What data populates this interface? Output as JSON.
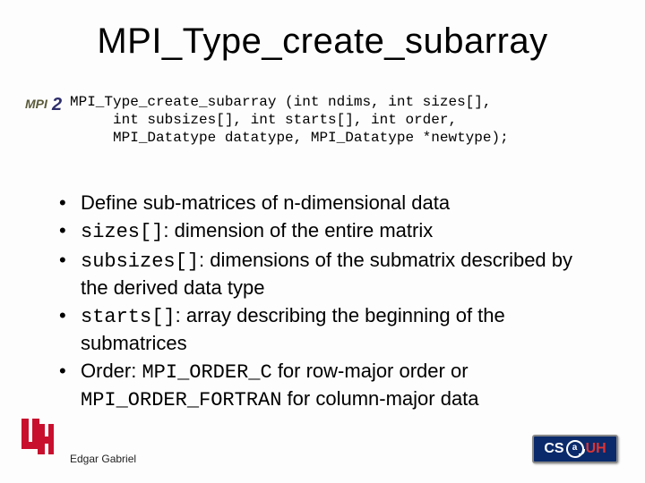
{
  "title": "MPI_Type_create_subarray",
  "signature": "MPI_Type_create_subarray (int ndims, int sizes[],\n     int subsizes[], int starts[], int order,\n     MPI_Datatype datatype, MPI_Datatype *newtype);",
  "bullets": [
    {
      "pre": "",
      "code": "",
      "post": "Define sub-matrices of n-dimensional data"
    },
    {
      "pre": "",
      "code": "sizes[]",
      "post": ": dimension of the entire matrix"
    },
    {
      "pre": "",
      "code": "subsizes[]",
      "post": ": dimensions of the submatrix described by the derived data type"
    },
    {
      "pre": "",
      "code": "starts[]",
      "post": ": array describing the beginning of the submatrices"
    },
    {
      "pre": "Order: ",
      "code": "MPI_ORDER_C",
      "post": " for row-major order or ",
      "code2": "MPI_ORDER_FORTRAN",
      "post2": " for column-major data"
    }
  ],
  "logos": {
    "mpi2_mpi": "MPI",
    "mpi2_two": "2",
    "csuh_cs": "CS",
    "csuh_at": "a",
    "csuh_uh": "UH"
  },
  "author": "Edgar Gabriel"
}
